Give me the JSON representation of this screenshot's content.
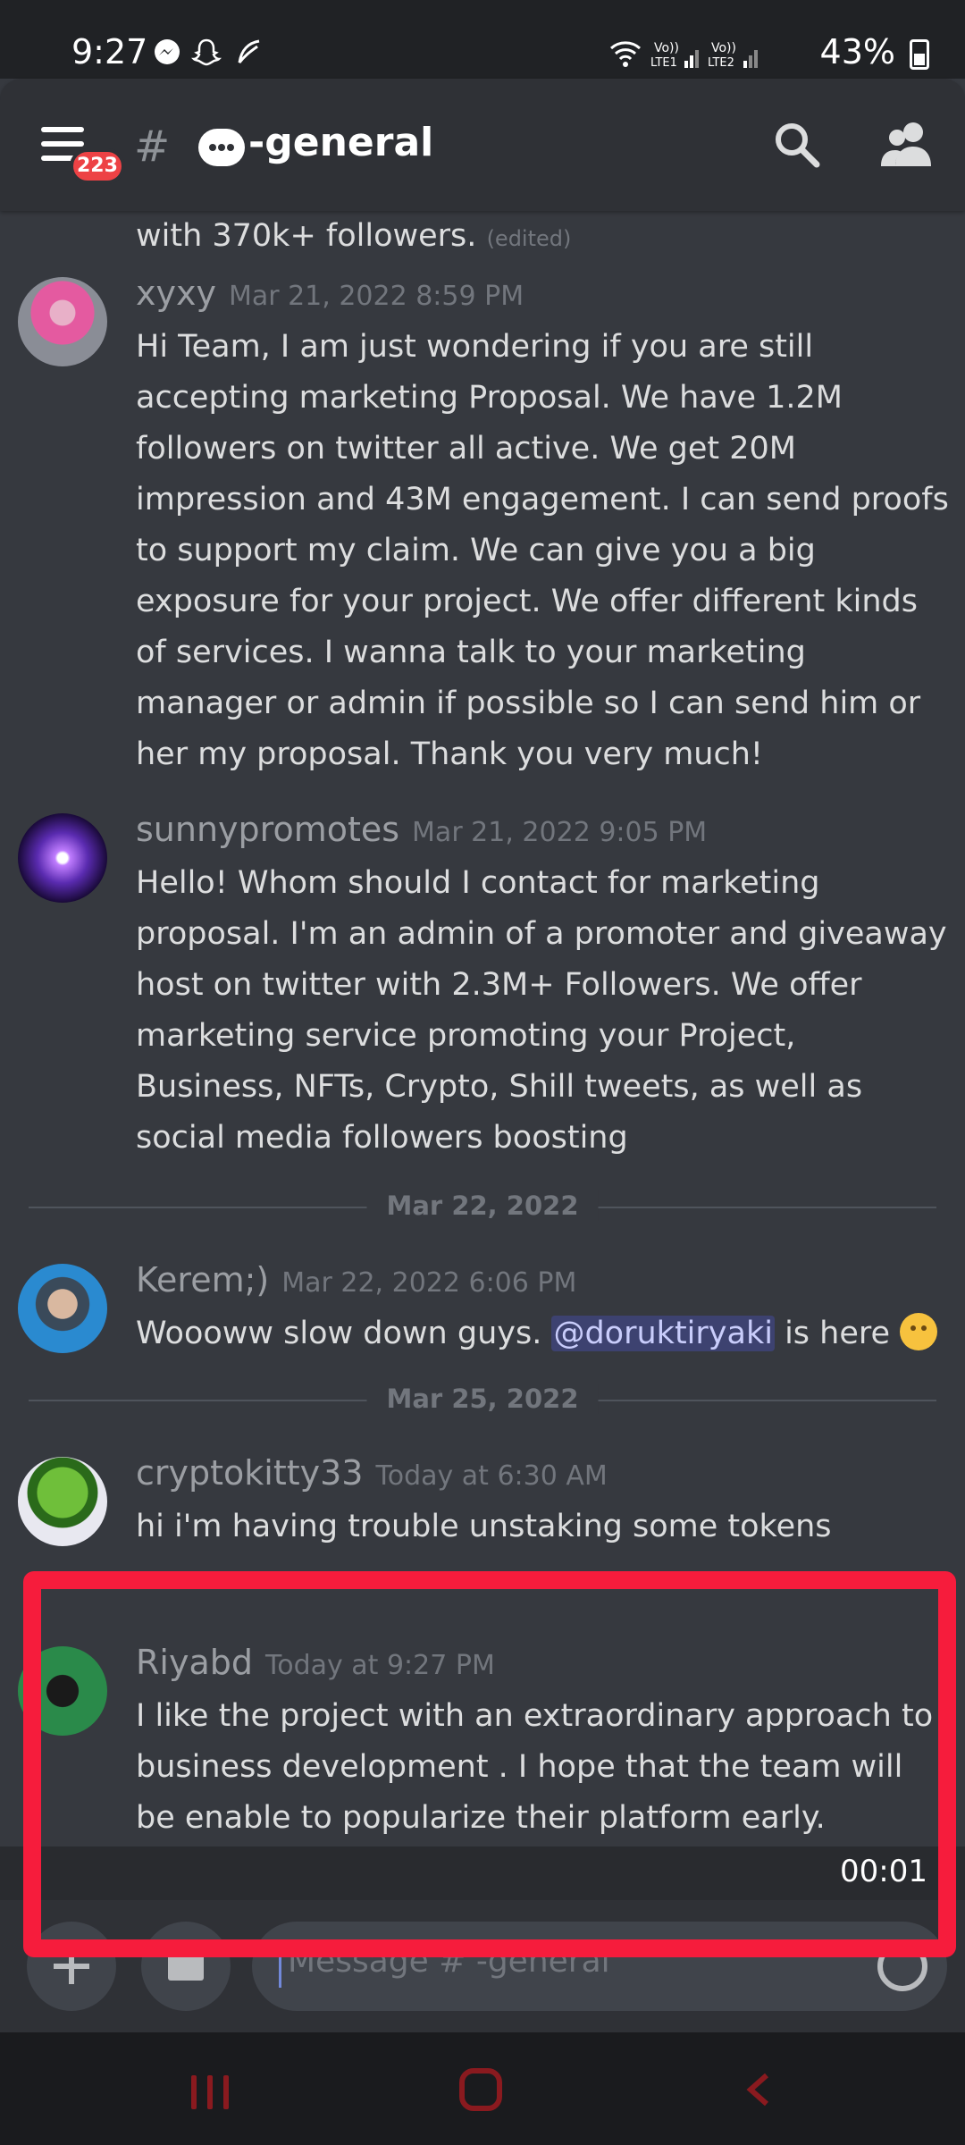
{
  "status_bar": {
    "time": "9:27",
    "battery": "43%",
    "icons": [
      "messenger-icon",
      "snapchat-icon",
      "feather-icon",
      "wifi-icon",
      "signal-icon"
    ]
  },
  "header": {
    "channel_name": "-general",
    "badge_count": "223"
  },
  "messages_top": {
    "text": "with 370k+ followers.",
    "edited": "(edited)"
  },
  "messages": [
    {
      "username": "xyxy",
      "timestamp": "Mar 21, 2022 8:59 PM",
      "text": "Hi Team,  I am just wondering if you are still accepting marketing Proposal. We have 1.2M followers on twitter all active. We get 20M impression and 43M engagement. I can send proofs to support my claim. We can give you a big exposure for your project. We offer different kinds of services. I wanna talk to your marketing manager or admin if possible so I can send him or her my proposal. Thank you very much!"
    },
    {
      "username": "sunnypromotes",
      "timestamp": "Mar 21, 2022 9:05 PM",
      "text": "Hello! Whom should I contact for marketing proposal. I'm an admin of a promoter and giveaway host on twitter with 2.3M+ Followers. We offer marketing service promoting your Project, Business, NFTs, Crypto, Shill tweets, as well as social media followers boosting"
    },
    {
      "username": "Kerem;)",
      "timestamp": "Mar 22, 2022 6:06 PM",
      "text_before": "Woooww slow down guys. ",
      "mention": "@doruktiryaki",
      "text_after": " is here "
    },
    {
      "username": "cryptokitty33",
      "timestamp": "Today at 6:30 AM",
      "text": "hi i'm having trouble unstaking some tokens"
    },
    {
      "username": "Riyabd",
      "timestamp": "Today at 9:27 PM",
      "text": "I like the project with an extraordinary approach to business development . I hope that the team will be enable to popularize their platform early."
    }
  ],
  "dividers": [
    "Mar 22, 2022",
    "Mar 25, 2022"
  ],
  "timer": "00:01",
  "composer": {
    "placeholder": "Message #",
    "placeholder_suffix": "-general"
  },
  "colors": {
    "background": "#36393f",
    "header": "#2f3136",
    "badge": "#ed4245",
    "highlight": "#f61c3c",
    "mention_bg": "#3d4270"
  }
}
